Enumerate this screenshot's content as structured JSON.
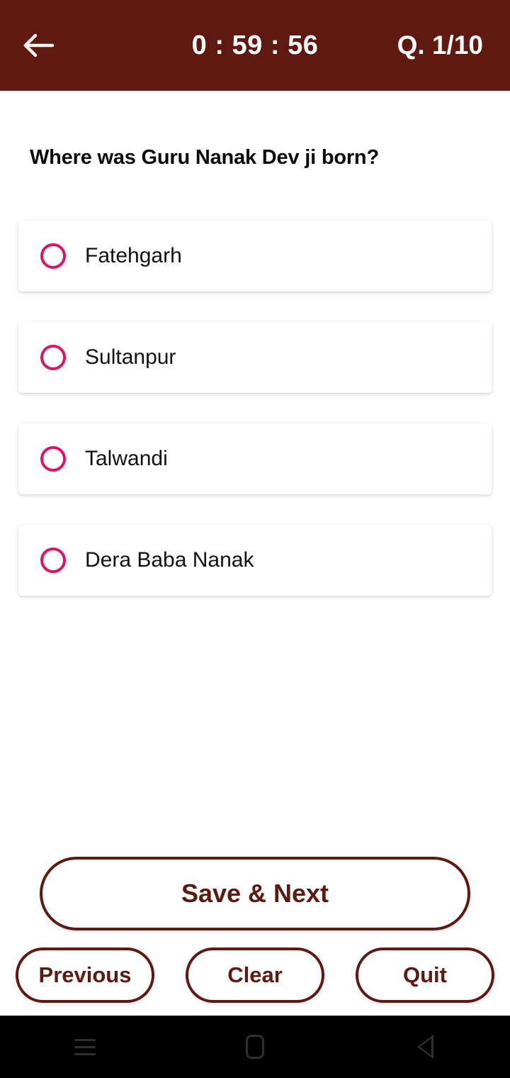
{
  "header": {
    "back_icon": "arrow-left-icon",
    "timer": "0 : 59 : 56",
    "question_counter": "Q. 1/10",
    "background_color": "#5E1A10",
    "text_color": "#FFFFFF"
  },
  "quiz": {
    "question": "Where was Guru Nanak Dev ji born?",
    "accent_color": "#DD1366",
    "options": [
      {
        "label": "Fatehgarh",
        "selected": false
      },
      {
        "label": "Sultanpur",
        "selected": false
      },
      {
        "label": "Talwandi",
        "selected": false
      },
      {
        "label": "Dera Baba Nanak",
        "selected": false
      }
    ]
  },
  "footer": {
    "save_next_label": "Save & Next",
    "previous_label": "Previous",
    "clear_label": "Clear",
    "quit_label": "Quit",
    "button_color": "#5E1A10"
  },
  "navbar": {
    "recents_icon": "menu-lines-icon",
    "home_icon": "home-square-icon",
    "back_icon": "back-triangle-icon"
  }
}
